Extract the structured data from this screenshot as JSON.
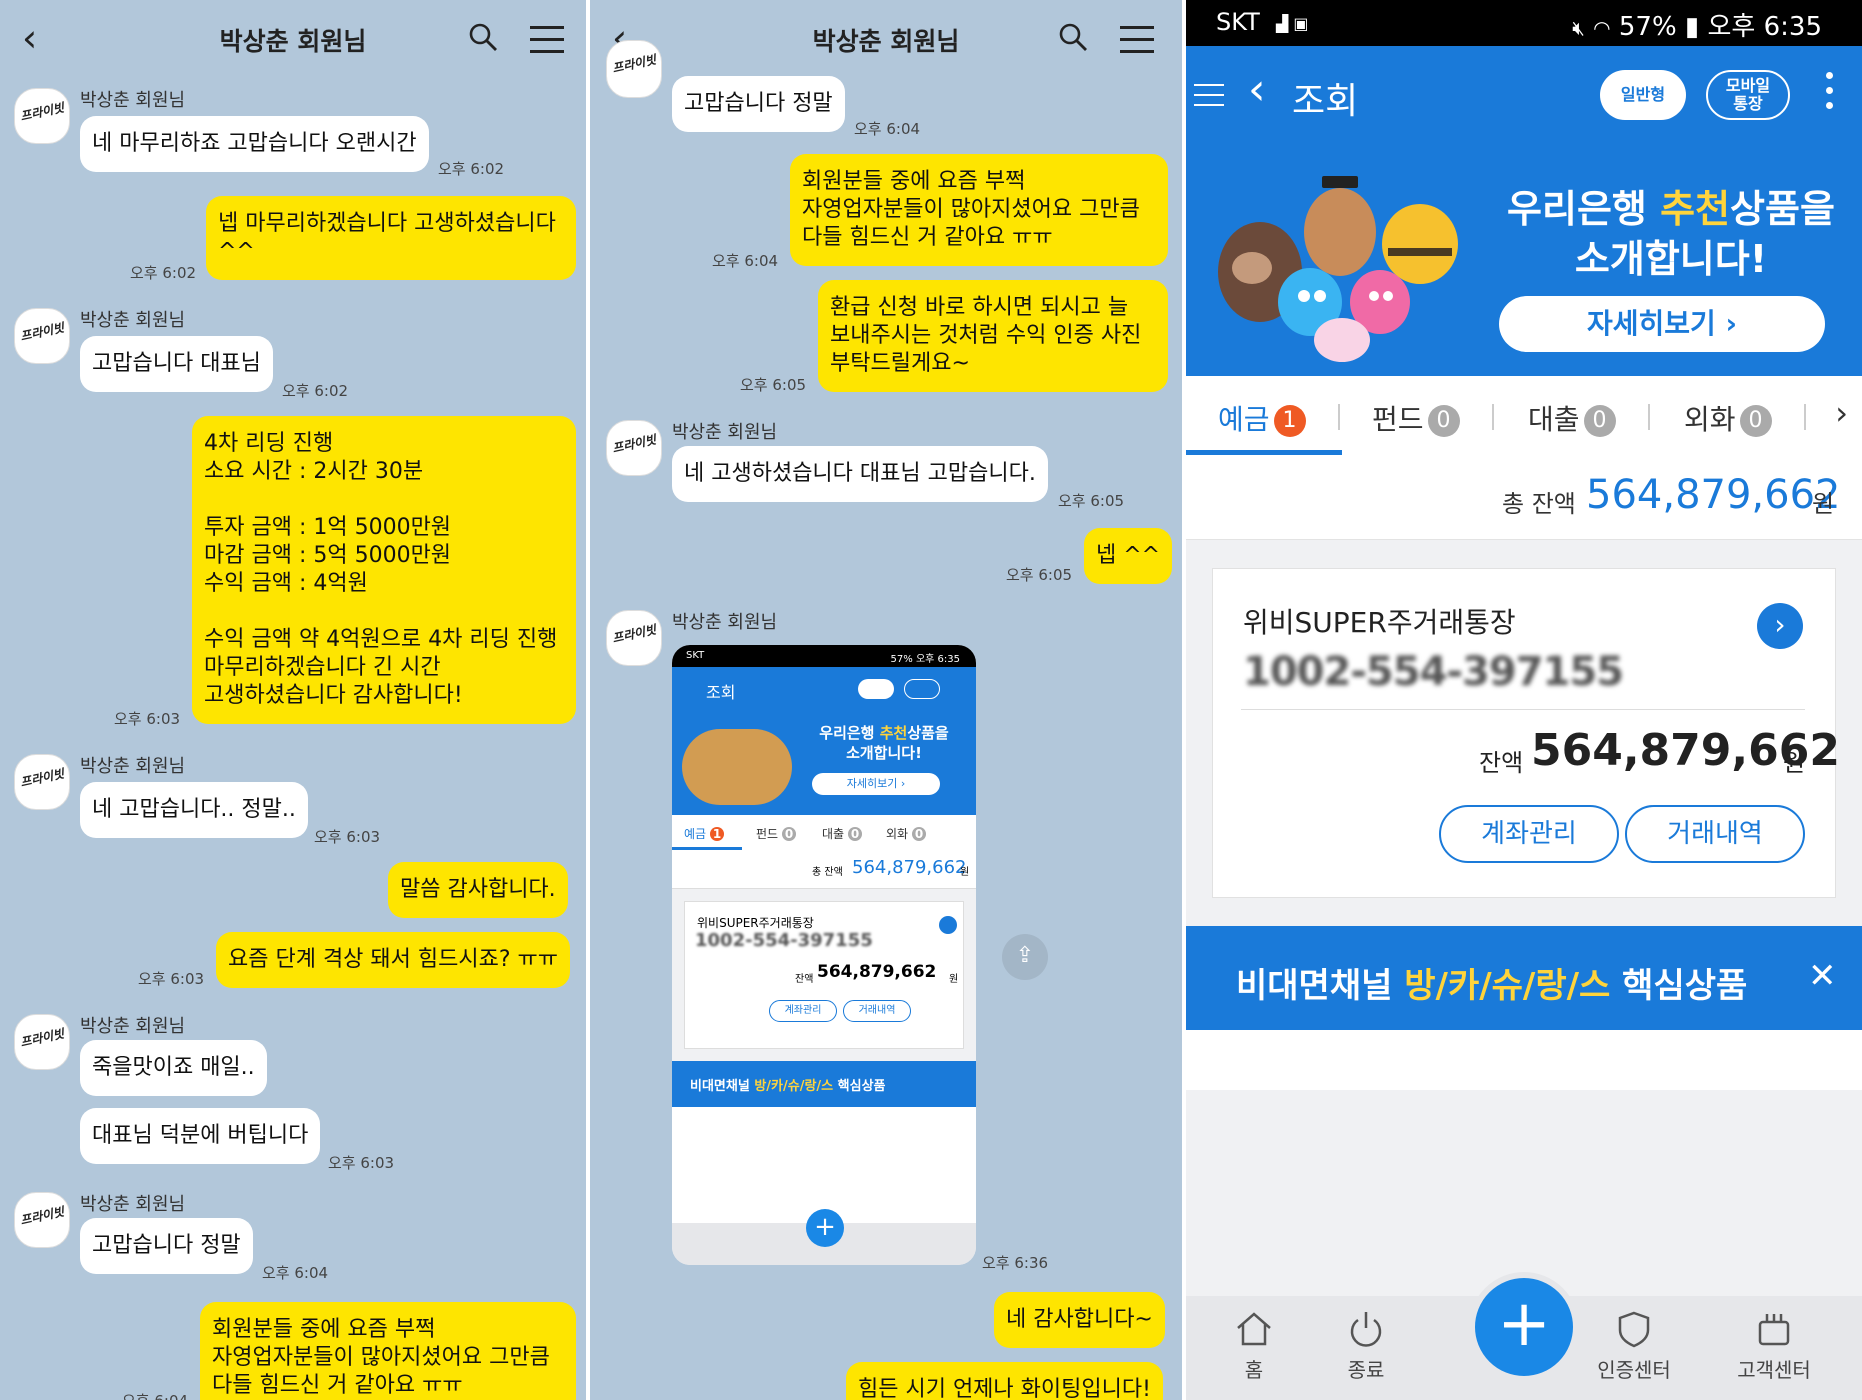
{
  "chat1": {
    "title": "박상춘 회원님",
    "messages": [
      {
        "sender": "박상춘 회원님",
        "text": "네 마무리하죠 고맙습니다 오랜시간",
        "time": "오후 6:02"
      },
      {
        "text": "넵 마무리하겠습니다 고생하셨습니다\n^^",
        "time": "오후 6:02"
      },
      {
        "sender": "박상춘 회원님",
        "text": "고맙습니다 대표님",
        "time": "오후 6:02"
      },
      {
        "text": "4차 리딩 진행\n소요 시간 : 2시간 30분\n\n투자 금액 : 1억 5000만원\n마감 금액 : 5억 5000만원\n수익 금액 : 4억원\n\n수익 금액 약 4억원으로 4차 리딩 진행\n마무리하겠습니다 긴 시간\n고생하셨습니다 감사합니다!",
        "time": "오후 6:03"
      },
      {
        "sender": "박상춘 회원님",
        "text": "네 고맙습니다.. 정말..",
        "time": "오후 6:03"
      },
      {
        "text": "말씀 감사합니다."
      },
      {
        "text": "요즘 단계 격상 돼서 힘드시죠? ㅠㅠ",
        "time": "오후 6:03"
      },
      {
        "sender": "박상춘 회원님",
        "text": "죽을맛이죠 매일.."
      },
      {
        "text": "대표님 덕분에 버팁니다",
        "time": "오후 6:03"
      },
      {
        "sender": "박상춘 회원님",
        "text": "고맙습니다 정말",
        "time": "오후 6:04"
      },
      {
        "text": "회원분들 중에 요즘 부쩍\n자영업자분들이 많아지셨어요 그만큼\n다들 힘드신 거 같아요 ㅠㅠ",
        "time": "오후 6:04"
      }
    ]
  },
  "chat2": {
    "title": "박상춘 회원님",
    "messages": [
      {
        "text": "고맙습니다 정말",
        "time": "오후 6:04"
      },
      {
        "text": "회원분들 중에 요즘 부쩍\n자영업자분들이 많아지셨어요 그만큼\n다들 힘드신 거 같아요 ㅠㅠ",
        "time": "오후 6:04"
      },
      {
        "text": "환급 신청 바로 하시면 되시고 늘\n보내주시는 것처럼 수익 인증 사진\n부탁드릴게요~",
        "time": "오후 6:05"
      },
      {
        "sender": "박상춘 회원님",
        "text": "네 고생하셨습니다 대표님 고맙습니다.",
        "time": "오후 6:05"
      },
      {
        "text": "넵 ^^",
        "time": "오후 6:05"
      },
      {
        "sender": "박상춘 회원님",
        "time": "오후 6:36"
      },
      {
        "text": "네 감사합니다~"
      },
      {
        "text": "힘든 시기 언제나 화이팅입니다!"
      }
    ]
  },
  "bank": {
    "status": {
      "carrier": "SKT",
      "battery": "57%",
      "time": "오후 6:35"
    },
    "appbar": {
      "title": "조회",
      "pill_general": "일반형",
      "pill_mobile": "모바일\n통장"
    },
    "banner": {
      "line1_pre": "우리은행 ",
      "line1_hl": "추천",
      "line1_post": "상품을",
      "line2": "소개합니다!",
      "button": "자세히보기 ›"
    },
    "tabs": [
      {
        "label": "예금",
        "count": "1"
      },
      {
        "label": "펀드",
        "count": "0"
      },
      {
        "label": "대출",
        "count": "0"
      },
      {
        "label": "외화",
        "count": "0"
      }
    ],
    "total": {
      "label": "총 잔액",
      "value": "564,879,662",
      "unit": "원"
    },
    "account": {
      "name": "위비SUPER주거래통장",
      "number": "1002-554-397155",
      "balance_label": "잔액",
      "balance": "564,879,662",
      "unit": "원",
      "btn_manage": "계좌관리",
      "btn_history": "거래내역"
    },
    "promo": {
      "pre": "비대면채널 ",
      "hl": "방/카/슈/랑/스",
      "post": " 핵심상품"
    },
    "nav": [
      "홈",
      "종료",
      "인증센터",
      "고객센터"
    ],
    "colors": {
      "primary": "#1a7ad9",
      "accent": "#ffd43b",
      "badge": "#ef5a24"
    }
  },
  "mini": {
    "title": "조회",
    "banner1_pre": "우리은행 ",
    "banner1_hl": "추천",
    "banner1_post": "상품을",
    "banner2": "소개합니다!",
    "banner_btn": "자세히보기 ›",
    "total_label": "총 잔액",
    "total_value": "564,879,662",
    "unit": "원",
    "account_name": "위비SUPER주거래통장",
    "account_number": "1002-554-397155",
    "balance_label": "잔액",
    "balance": "564,879,662",
    "btn_manage": "계좌관리",
    "btn_history": "거래내역",
    "promo_pre": "비대면채널 ",
    "promo_hl": "방/카/슈/랑/스",
    "promo_post": " 핵심상품",
    "status_left": "SKT",
    "status_right": "57% 오후 6:35"
  },
  "avatar_text": "프라이빗 투자의 이야기"
}
